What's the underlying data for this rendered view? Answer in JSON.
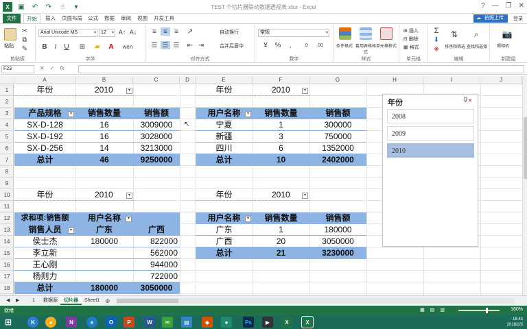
{
  "window": {
    "title": "TEST 个切片器联动数据透视表.xlsx - Excel",
    "quick_access": [
      "save-icon",
      "undo-icon",
      "redo-icon",
      "touch-icon",
      "customize-icon"
    ],
    "controls": [
      "?",
      "—",
      "❐",
      "✕"
    ]
  },
  "tabs": [
    "文件",
    "开始",
    "插入",
    "页面布局",
    "公式",
    "数据",
    "审阅",
    "视图",
    "开发工具"
  ],
  "account": {
    "signin": "拍照上传",
    "user": "登录"
  },
  "ribbon": {
    "clipboard": {
      "label": "剪贴板",
      "paste": "粘贴"
    },
    "font": {
      "label": "字体",
      "name": "Arial Unicode MS",
      "size": "12",
      "b": "B",
      "i": "I",
      "u": "U"
    },
    "alignment": {
      "label": "对齐方式",
      "wrap": "自动换行",
      "merge": "合并后居中"
    },
    "number": {
      "label": "数字",
      "format": "常规"
    },
    "styles": {
      "label": "样式",
      "cond": "条件格式",
      "table": "套用表格格式",
      "cell": "单元格样式"
    },
    "cells": {
      "label": "单元格",
      "insert": "插入",
      "delete": "删除",
      "format": "格式"
    },
    "editing": {
      "label": "编辑",
      "sort": "排序和筛选",
      "find": "查找和选择"
    },
    "extra": {
      "label": "新建组",
      "shot": "照相机"
    }
  },
  "formula_bar": {
    "name_box": "F23",
    "cancel": "✕",
    "enter": "✓",
    "fx": "fx",
    "value": ""
  },
  "columns": [
    "A",
    "B",
    "C",
    "D",
    "E",
    "F",
    "G",
    "H",
    "I",
    "J"
  ],
  "rows": [
    "1",
    "2",
    "3",
    "4",
    "5",
    "6",
    "7",
    "8",
    "9",
    "10",
    "11",
    "12",
    "13",
    "14",
    "15",
    "16",
    "17",
    "18"
  ],
  "pivot1": {
    "filter_label": "年份",
    "filter_value": "2010",
    "headers": [
      "产品规格",
      "销售数量",
      "销售额"
    ],
    "rows": [
      [
        "SX-D-128",
        "16",
        "3009000"
      ],
      [
        "SX-D-192",
        "16",
        "3028000"
      ],
      [
        "SX-D-256",
        "14",
        "3213000"
      ]
    ],
    "total": [
      "总计",
      "46",
      "9250000"
    ]
  },
  "pivot2": {
    "filter_label": "年份",
    "filter_value": "2010",
    "headers": [
      "用户名称",
      "销售数量",
      "销售额"
    ],
    "rows": [
      [
        "宁夏",
        "1",
        "300000"
      ],
      [
        "新疆",
        "3",
        "750000"
      ],
      [
        "四川",
        "6",
        "1352000"
      ]
    ],
    "total": [
      "总计",
      "10",
      "2402000"
    ]
  },
  "pivot3": {
    "filter_label": "年份",
    "filter_value": "2010",
    "corner": "求和项:销售额",
    "col_field": "用户名称",
    "row_field": "销售人员",
    "cols": [
      "广东",
      "广西"
    ],
    "rows": [
      [
        "侯士杰",
        "180000",
        "822000"
      ],
      [
        "李立新",
        "",
        "562000"
      ],
      [
        "王心刚",
        "",
        "944000"
      ],
      [
        "杨则力",
        "",
        "722000"
      ]
    ],
    "total": [
      "总计",
      "180000",
      "3050000"
    ]
  },
  "pivot4": {
    "filter_label": "年份",
    "filter_value": "2010",
    "headers": [
      "用户名称",
      "销售数量",
      "销售额"
    ],
    "rows": [
      [
        "广东",
        "1",
        "180000"
      ],
      [
        "广西",
        "20",
        "3050000"
      ]
    ],
    "total": [
      "总计",
      "21",
      "3230000"
    ]
  },
  "slicer": {
    "title": "年份",
    "items": [
      "2008",
      "2009",
      "2010"
    ],
    "selected": "2010"
  },
  "sheets": {
    "tabs": [
      "1",
      "数据源",
      "切片器",
      "Sheet1"
    ],
    "active": "切片器",
    "add": "⊕"
  },
  "status": {
    "text": "就绪",
    "zoom": "160%"
  },
  "taskbar": {
    "time": "16:43",
    "date": "2018/2/3"
  }
}
